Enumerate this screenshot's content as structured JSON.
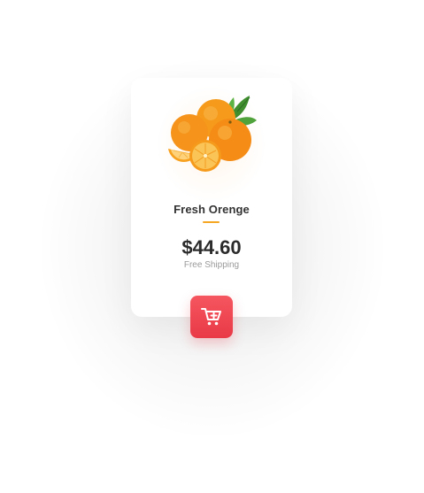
{
  "product": {
    "title": "Fresh Orenge",
    "price": "$44.60",
    "shipping": "Free Shipping",
    "image_icon": "orange-fruit-icon"
  },
  "cart": {
    "icon": "add-to-cart-icon"
  },
  "colors": {
    "accent": "#f5a623",
    "cart_button": "#ef4552",
    "price_text": "#2b2b2b",
    "muted_text": "#9a9a9a"
  }
}
